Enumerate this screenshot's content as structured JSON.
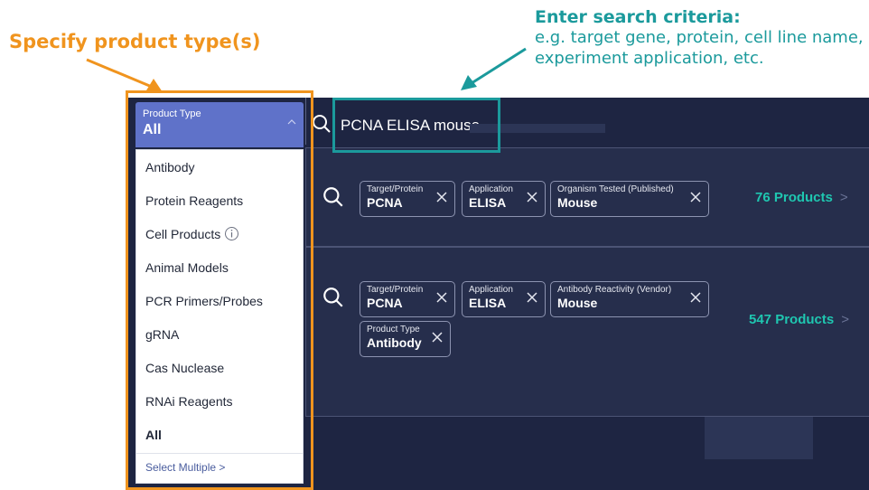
{
  "annotations": {
    "left_title": "Specify product type(s)",
    "right_title": "Enter search criteria:",
    "right_desc_line1": "e.g. target gene, protein, cell line name,",
    "right_desc_line2": "experiment application, etc."
  },
  "search": {
    "value": "PCNA ELISA mouse"
  },
  "product_type_dropdown": {
    "label": "Product Type",
    "selected": "All",
    "options": [
      "Antibody",
      "Protein Reagents",
      "Cell Products",
      "Animal Models",
      "PCR Primers/Probes",
      "gRNA",
      "Cas Nuclease",
      "RNAi Reagents",
      "All"
    ],
    "select_multiple": "Select Multiple >"
  },
  "suggestions": [
    {
      "chips": [
        {
          "label": "Target/Protein",
          "value": "PCNA"
        },
        {
          "label": "Application",
          "value": "ELISA"
        },
        {
          "label": "Organism Tested (Published)",
          "value": "Mouse"
        }
      ],
      "count": "76 Products"
    },
    {
      "chips": [
        {
          "label": "Target/Protein",
          "value": "PCNA"
        },
        {
          "label": "Application",
          "value": "ELISA"
        },
        {
          "label": "Antibody Reactivity (Vendor)",
          "value": "Mouse"
        },
        {
          "label": "Product Type",
          "value": "Antibody"
        }
      ],
      "count": "547 Products"
    }
  ],
  "colors": {
    "annotation_orange": "#f0941e",
    "annotation_teal": "#1b9a9c",
    "app_background": "#1e2542",
    "dropdown_header": "#5f72c9",
    "count_green": "#1fc6b0"
  }
}
